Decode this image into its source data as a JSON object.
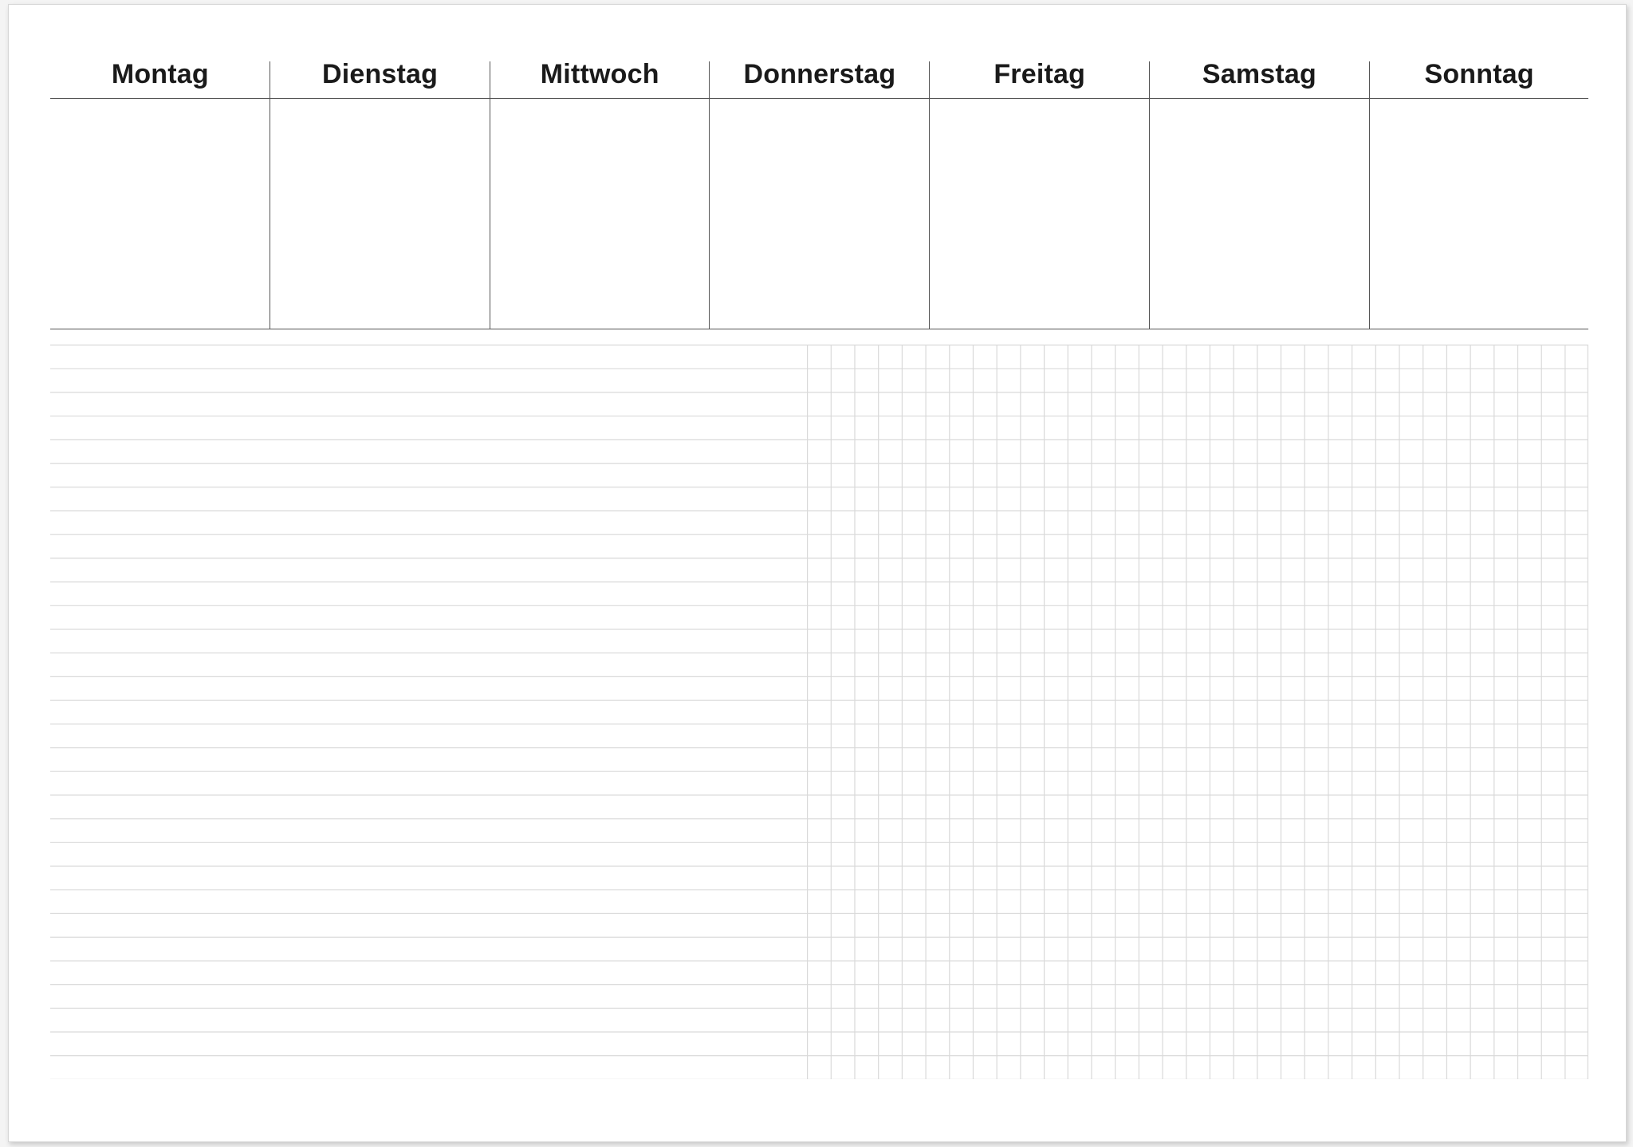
{
  "planner": {
    "days": [
      "Montag",
      "Dienstag",
      "Mittwoch",
      "Donnerstag",
      "Freitag",
      "Samstag",
      "Sonntag"
    ]
  },
  "colors": {
    "paper": "#ffffff",
    "background": "#f4f4f4",
    "rule": "#555555",
    "light_rule": "#d9d9d9",
    "text": "#1a1a1a"
  }
}
